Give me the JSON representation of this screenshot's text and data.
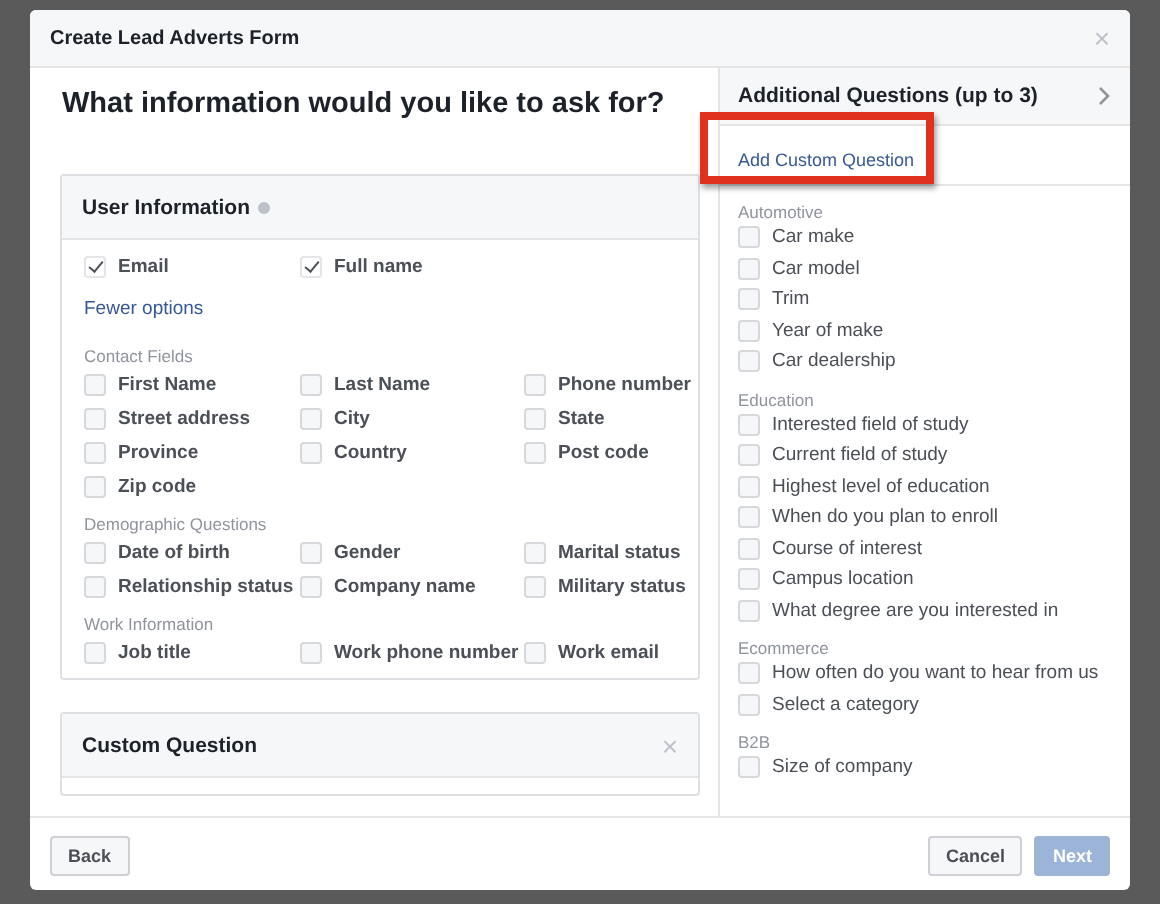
{
  "dialog": {
    "title": "Create Lead Adverts Form",
    "close": "×"
  },
  "left": {
    "heading": "What information would you like to ask for?",
    "user_info": {
      "title": "User Information",
      "top_fields": [
        {
          "label": "Email",
          "checked": true
        },
        {
          "label": "Full name",
          "checked": true
        }
      ],
      "link": "Fewer options",
      "groups": [
        {
          "title": "Contact Fields",
          "items": [
            {
              "label": "First Name",
              "checked": false
            },
            {
              "label": "Last Name",
              "checked": false
            },
            {
              "label": "Phone number",
              "checked": false
            },
            {
              "label": "Street address",
              "checked": false
            },
            {
              "label": "City",
              "checked": false
            },
            {
              "label": "State",
              "checked": false
            },
            {
              "label": "Province",
              "checked": false
            },
            {
              "label": "Country",
              "checked": false
            },
            {
              "label": "Post code",
              "checked": false
            },
            {
              "label": "Zip code",
              "checked": false
            }
          ]
        },
        {
          "title": "Demographic Questions",
          "items": [
            {
              "label": "Date of birth",
              "checked": false
            },
            {
              "label": "Gender",
              "checked": false
            },
            {
              "label": "Marital status",
              "checked": false
            },
            {
              "label": "Relationship status",
              "checked": false
            },
            {
              "label": "Company name",
              "checked": false
            },
            {
              "label": "Military status",
              "checked": false
            }
          ]
        },
        {
          "title": "Work Information",
          "items": [
            {
              "label": "Job title",
              "checked": false
            },
            {
              "label": "Work phone number",
              "checked": false
            },
            {
              "label": "Work email",
              "checked": false
            }
          ]
        }
      ]
    },
    "custom_question": {
      "title": "Custom Question",
      "close": "×"
    }
  },
  "right": {
    "title": "Additional Questions (up to 3)",
    "add_link": "Add Custom Question",
    "highlighted": true,
    "categories": [
      {
        "title": "Automotive",
        "items": [
          {
            "label": "Car make",
            "checked": false
          },
          {
            "label": "Car model",
            "checked": false
          },
          {
            "label": "Trim",
            "checked": false
          },
          {
            "label": "Year of make",
            "checked": false
          },
          {
            "label": "Car dealership",
            "checked": false
          }
        ]
      },
      {
        "title": "Education",
        "items": [
          {
            "label": "Interested field of study",
            "checked": false
          },
          {
            "label": "Current field of study",
            "checked": false
          },
          {
            "label": "Highest level of education",
            "checked": false
          },
          {
            "label": "When do you plan to enroll",
            "checked": false
          },
          {
            "label": "Course of interest",
            "checked": false
          },
          {
            "label": "Campus location",
            "checked": false
          },
          {
            "label": "What degree are you interested in",
            "checked": false
          }
        ]
      },
      {
        "title": "Ecommerce",
        "items": [
          {
            "label": "How often do you want to hear from us",
            "checked": false
          },
          {
            "label": "Select a category",
            "checked": false
          }
        ]
      },
      {
        "title": "B2B",
        "items": [
          {
            "label": "Size of company",
            "checked": false
          }
        ]
      }
    ]
  },
  "footer": {
    "back": "Back",
    "cancel": "Cancel",
    "next": {
      "label": "Next",
      "disabled": true
    }
  }
}
